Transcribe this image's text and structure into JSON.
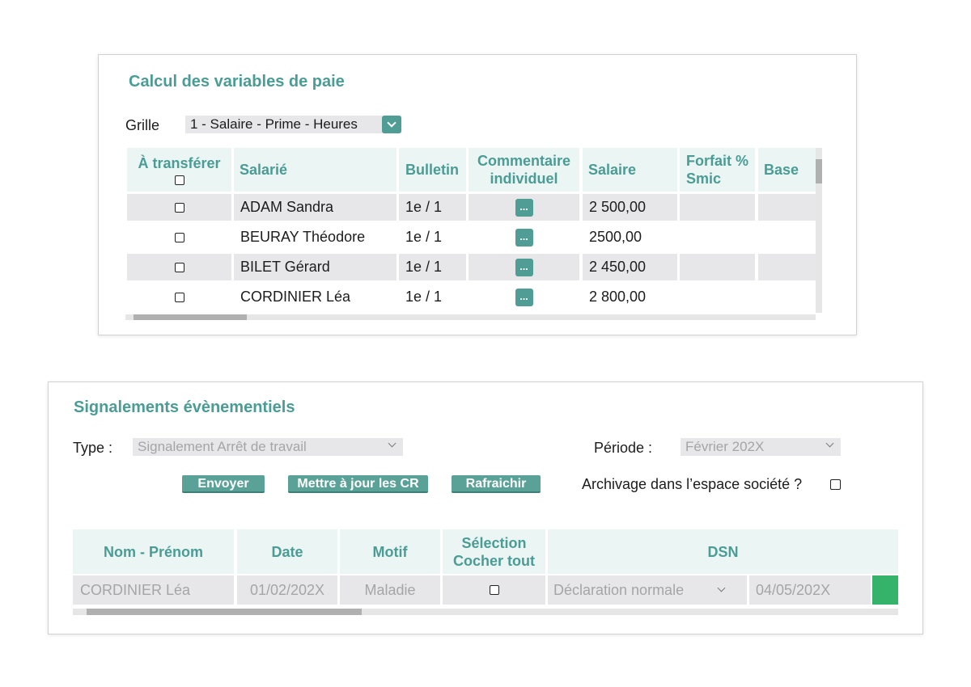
{
  "payroll": {
    "title": "Calcul des variables de paie",
    "grille_label": "Grille",
    "grille_value": "1 - Salaire - Prime - Heures",
    "headers": {
      "transfer": "À transférer",
      "salarie": "Salarié",
      "bulletin": "Bulletin",
      "commentaire_1": "Commentaire",
      "commentaire_2": "individuel",
      "salaire": "Salaire",
      "forfait_1": "Forfait %",
      "forfait_2": "Smic",
      "base": "Base"
    },
    "comment_button": "...",
    "rows": [
      {
        "name": "ADAM Sandra",
        "bulletin": "1e / 1",
        "salaire": "2 500,00"
      },
      {
        "name": "BEURAY Théodore",
        "bulletin": "1e / 1",
        "salaire": "2500,00"
      },
      {
        "name": "BILET Gérard",
        "bulletin": "1e / 1",
        "salaire": "2 450,00"
      },
      {
        "name": "CORDINIER Léa",
        "bulletin": "1e / 1",
        "salaire": "2 800,00"
      }
    ]
  },
  "events": {
    "title": "Signalements évènementiels",
    "type_label": "Type :",
    "type_value": "Signalement Arrêt de travail",
    "periode_label": "Période :",
    "periode_value": "Février 202X",
    "buttons": {
      "send": "Envoyer",
      "update": "Mettre à jour les CR",
      "refresh": "Rafraichir"
    },
    "archive_label": "Archivage dans l’espace société ?",
    "headers": {
      "name": "Nom - Prénom",
      "date": "Date",
      "motif": "Motif",
      "selection_1": "Sélection",
      "selection_2": "Cocher tout",
      "dsn": "DSN"
    },
    "rows": [
      {
        "name": "CORDINIER Léa",
        "date": "01/02/202X",
        "motif": "Maladie",
        "dsn_type": "Déclaration normale",
        "dsn_date": "04/05/202X"
      }
    ]
  },
  "colors": {
    "accent": "#4a9c94",
    "button": "#5aa198",
    "header_bg": "#eaf5f4",
    "row_gray": "#e7e7e9",
    "status_green": "#36b36b"
  }
}
